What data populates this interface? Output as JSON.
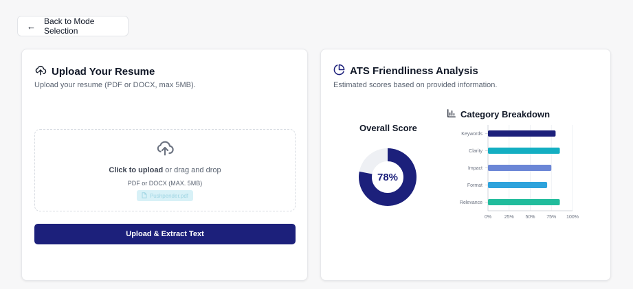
{
  "nav": {
    "back_label": "Back to Mode Selection"
  },
  "upload": {
    "title": "Upload Your Resume",
    "subtitle": "Upload your resume (PDF or DOCX, max 5MB).",
    "click_text": "Click to upload",
    "drag_text": " or drag and drop",
    "hint": "PDF or DOCX (MAX. 5MB)",
    "file_name": "Pushpender.pdf",
    "button_label": "Upload & Extract Text"
  },
  "ats": {
    "title": "ATS Friendliness Analysis",
    "subtitle": "Estimated scores based on provided information.",
    "overall_title": "Overall Score",
    "overall_value": 78,
    "overall_label": "78%",
    "breakdown_title": "Category Breakdown"
  },
  "colors": {
    "primary": "#1c207b",
    "donut_track": "#eef0f4"
  },
  "chart_data": {
    "type": "bar",
    "orientation": "horizontal",
    "title": "Category Breakdown",
    "categories": [
      "Keywords",
      "Clarity",
      "Impact",
      "Format",
      "Relevance"
    ],
    "values": [
      80,
      85,
      75,
      70,
      85
    ],
    "bar_colors": [
      "#1c207b",
      "#13aec2",
      "#6b86d6",
      "#2ea3dc",
      "#21bc9c"
    ],
    "xlim": [
      0,
      100
    ],
    "x_ticks": [
      "0%",
      "25%",
      "50%",
      "75%",
      "100%"
    ],
    "grid": true
  }
}
